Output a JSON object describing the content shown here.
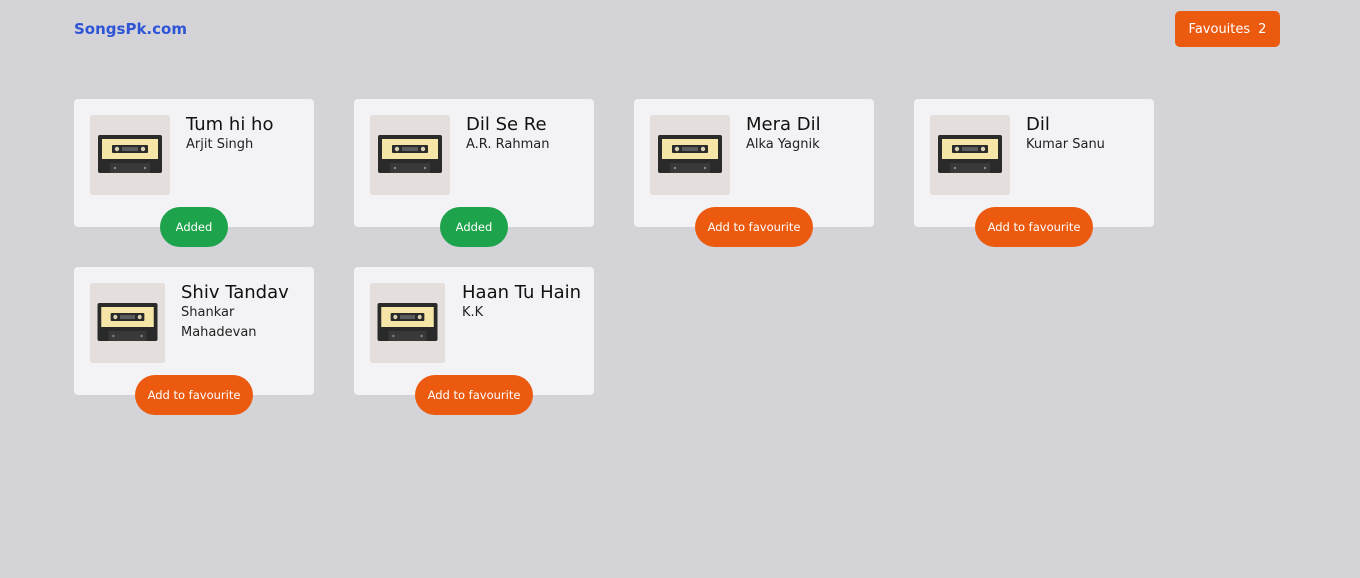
{
  "header": {
    "brand": "SongsPk.com",
    "favourites_label": "Favouites",
    "favourites_count": "2"
  },
  "songs": [
    {
      "title": "Tum hi ho",
      "artist": "Arjit Singh",
      "button": "Added",
      "is_favourite": true
    },
    {
      "title": "Dil Se Re",
      "artist": "A.R. Rahman",
      "button": "Added",
      "is_favourite": true
    },
    {
      "title": "Mera Dil",
      "artist": "Alka Yagnik",
      "button": "Add to favourite",
      "is_favourite": false
    },
    {
      "title": "Dil",
      "artist": "Kumar Sanu",
      "button": "Add to favourite",
      "is_favourite": false
    },
    {
      "title": "Shiv Tandav",
      "artist": "Shankar Mahadevan",
      "button": "Add to favourite",
      "is_favourite": false
    },
    {
      "title": "Haan Tu Hain",
      "artist": "K.K",
      "button": "Add to favourite",
      "is_favourite": false
    }
  ],
  "icons": {
    "thumbnail": "cassette-tape-icon"
  },
  "colors": {
    "background": "#d4d3d8",
    "brand": "#2d55d6",
    "accent": "#eb5a0f",
    "added": "#1da34b",
    "card": "#f3f2f5"
  }
}
